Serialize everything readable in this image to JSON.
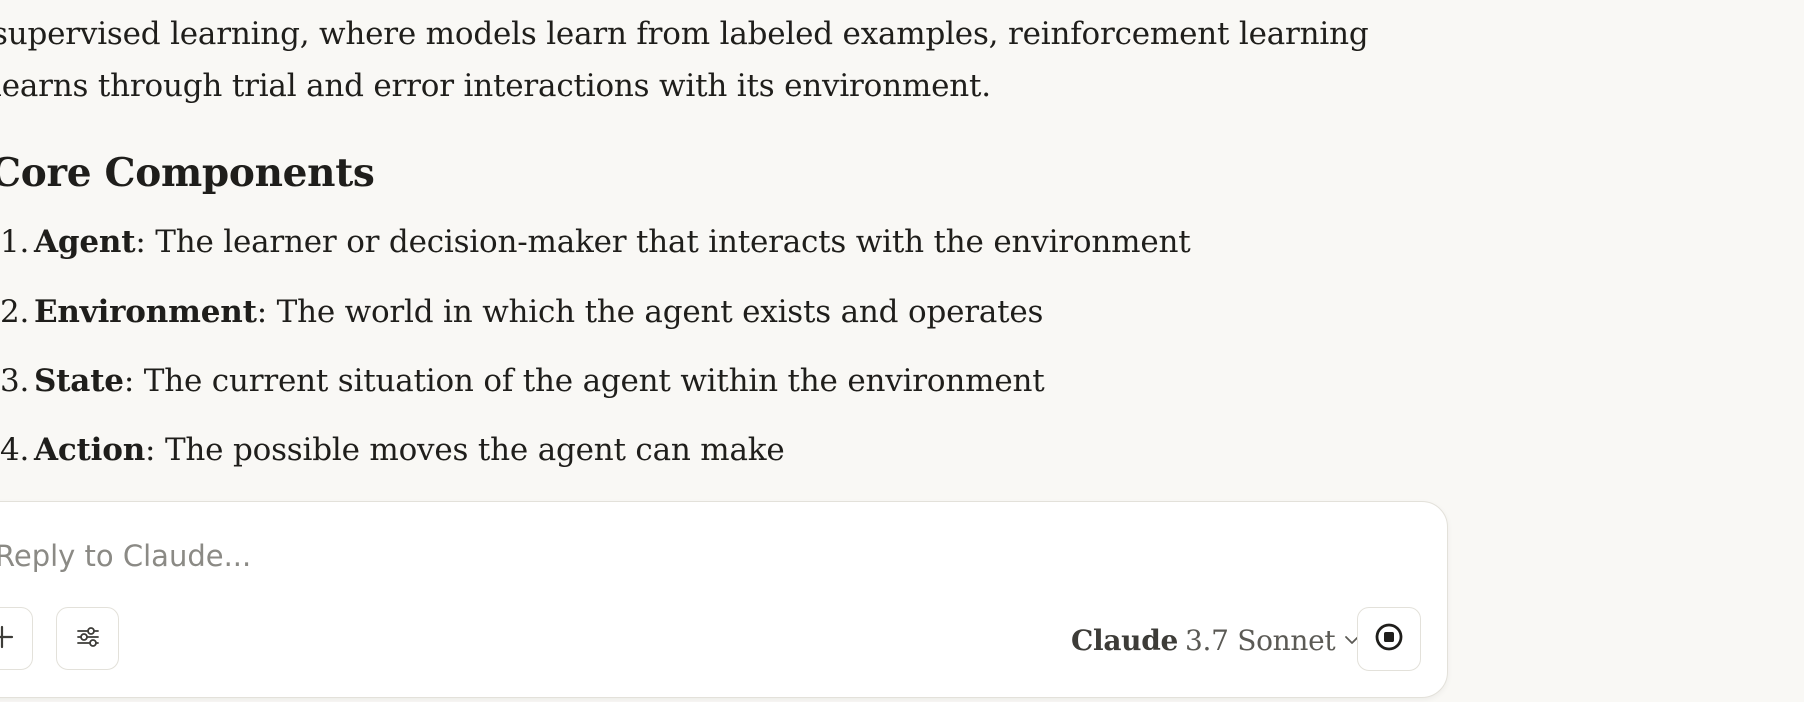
{
  "message": {
    "paragraph_lines": [
      "supervised learning, where models learn from labeled examples, reinforcement learning",
      "learns through trial and error interactions with its environment."
    ],
    "heading": "Core Components",
    "components": [
      {
        "number": "1.",
        "term": "Agent",
        "description": ": The learner or decision-maker that interacts with the environment"
      },
      {
        "number": "2.",
        "term": "Environment",
        "description": ": The world in which the agent exists and operates"
      },
      {
        "number": "3.",
        "term": "State",
        "description": ": The current situation of the agent within the environment"
      },
      {
        "number": "4.",
        "term": "Action",
        "description": ": The possible moves the agent can make"
      }
    ]
  },
  "composer": {
    "placeholder": "Reply to Claude...",
    "value": "",
    "model": {
      "brand": "Claude",
      "version": "3.7 Sonnet"
    },
    "icons": {
      "add": "plus-icon",
      "tools": "sliders-icon",
      "model_dropdown": "chevron-down-icon",
      "stop": "stop-icon"
    }
  },
  "colors": {
    "page_background": "#f9f8f5",
    "text": "#1f1e1b",
    "composer_border": "#e3e1da"
  }
}
